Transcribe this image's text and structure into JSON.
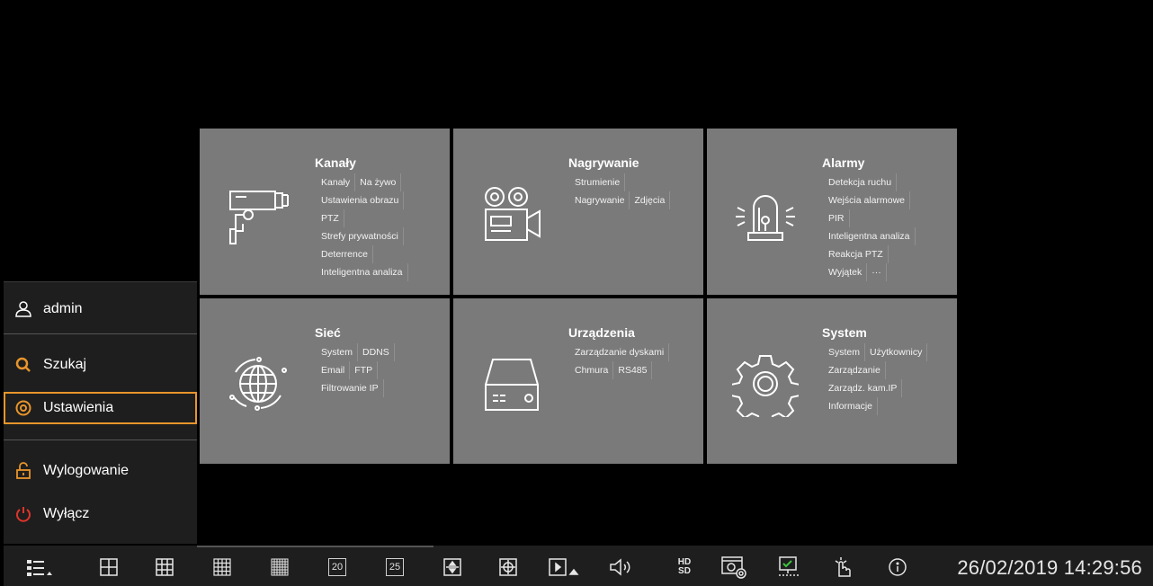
{
  "tiles": [
    {
      "title": "Kanały",
      "links": [
        [
          "Kanały",
          "Na żywo"
        ],
        [
          "Ustawienia obrazu"
        ],
        [
          "PTZ"
        ],
        [
          "Strefy prywatności"
        ],
        [
          "Deterrence"
        ],
        [
          "Inteligentna analiza"
        ]
      ]
    },
    {
      "title": "Nagrywanie",
      "links": [
        [
          "Strumienie"
        ],
        [
          "Nagrywanie",
          "Zdjęcia"
        ]
      ]
    },
    {
      "title": "Alarmy",
      "links": [
        [
          "Detekcja ruchu"
        ],
        [
          "Wejścia alarmowe"
        ],
        [
          "PIR"
        ],
        [
          "Inteligentna analiza"
        ],
        [
          "Reakcja PTZ"
        ],
        [
          "Wyjątek",
          "···"
        ]
      ]
    },
    {
      "title": "Sieć",
      "links": [
        [
          "System",
          "DDNS"
        ],
        [
          "Email",
          "FTP"
        ],
        [
          "Filtrowanie IP"
        ]
      ]
    },
    {
      "title": "Urządzenia",
      "links": [
        [
          "Zarządzanie dyskami"
        ],
        [
          "Chmura",
          "RS485"
        ]
      ]
    },
    {
      "title": "System",
      "links": [
        [
          "System",
          "Użytkownicy"
        ],
        [
          "Zarządzanie"
        ],
        [
          "Zarządz. kam.IP"
        ],
        [
          "Informacje"
        ]
      ]
    }
  ],
  "menu": {
    "user": "admin",
    "search": "Szukaj",
    "settings": "Ustawienia",
    "logout": "Wylogowanie",
    "shutdown": "Wyłącz"
  },
  "toolbar": {
    "split20": "20",
    "split25": "25",
    "hd": "HD",
    "sd": "SD",
    "datetime": "26/02/2019 14:29:56"
  },
  "colors": {
    "accent": "#e8952b",
    "shutdown": "#e0342c",
    "tile_bg": "#7a7a7a"
  },
  "icons": [
    "camera-icon",
    "film-camera-icon",
    "alarm-light-icon",
    "globe-network-icon",
    "hdd-device-icon",
    "gear-icon",
    "user-icon",
    "search-icon",
    "settings-icon",
    "unlock-icon",
    "power-icon"
  ]
}
